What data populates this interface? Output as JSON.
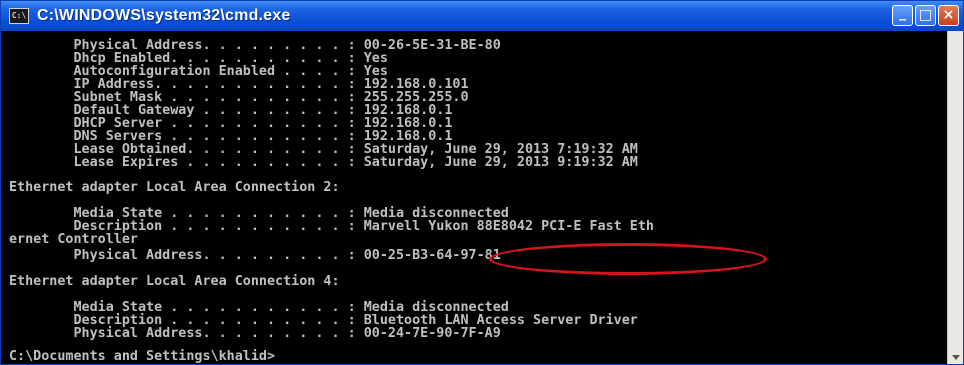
{
  "window": {
    "title": "C:\\WINDOWS\\system32\\cmd.exe",
    "icon": "cmd-console-icon",
    "icon_text": "C:\\",
    "minimize_label": "_",
    "maximize_label": "□",
    "close_label": "×"
  },
  "console": {
    "lines": [
      "        Physical Address. . . . . . . . . : 00-26-5E-31-BE-80",
      "        Dhcp Enabled. . . . . . . . . . . : Yes",
      "        Autoconfiguration Enabled . . . . : Yes",
      "        IP Address. . . . . . . . . . . . : 192.168.0.101",
      "        Subnet Mask . . . . . . . . . . . : 255.255.255.0",
      "        Default Gateway . . . . . . . . . : 192.168.0.1",
      "        DHCP Server . . . . . . . . . . . : 192.168.0.1",
      "        DNS Servers . . . . . . . . . . . : 192.168.0.1",
      "        Lease Obtained. . . . . . . . . . : Saturday, June 29, 2013 7:19:32 AM",
      "        Lease Expires . . . . . . . . . . : Saturday, June 29, 2013 9:19:32 AM",
      "",
      "Ethernet adapter Local Area Connection 2:",
      "",
      "        Media State . . . . . . . . . . . : Media disconnected",
      "        Description . . . . . . . . . . . : Marvell Yukon 88E8042 PCI-E Fast Eth",
      "ernet Controller",
      "        Physical Address. . . . . . . . . : 00-25-B3-64-97-81",
      "",
      "Ethernet adapter Local Area Connection 4:",
      "",
      "        Media State . . . . . . . . . . . : Media disconnected",
      "        Description . . . . . . . . . . . : Bluetooth LAN Access Server Driver",
      "        Physical Address. . . . . . . . . : 00-24-7E-90-7F-A9",
      "",
      "C:\\Documents and Settings\\khalid>"
    ],
    "text_color": "#c0c0c0",
    "background_color": "#000000",
    "highlight_color": "#d2141c"
  }
}
